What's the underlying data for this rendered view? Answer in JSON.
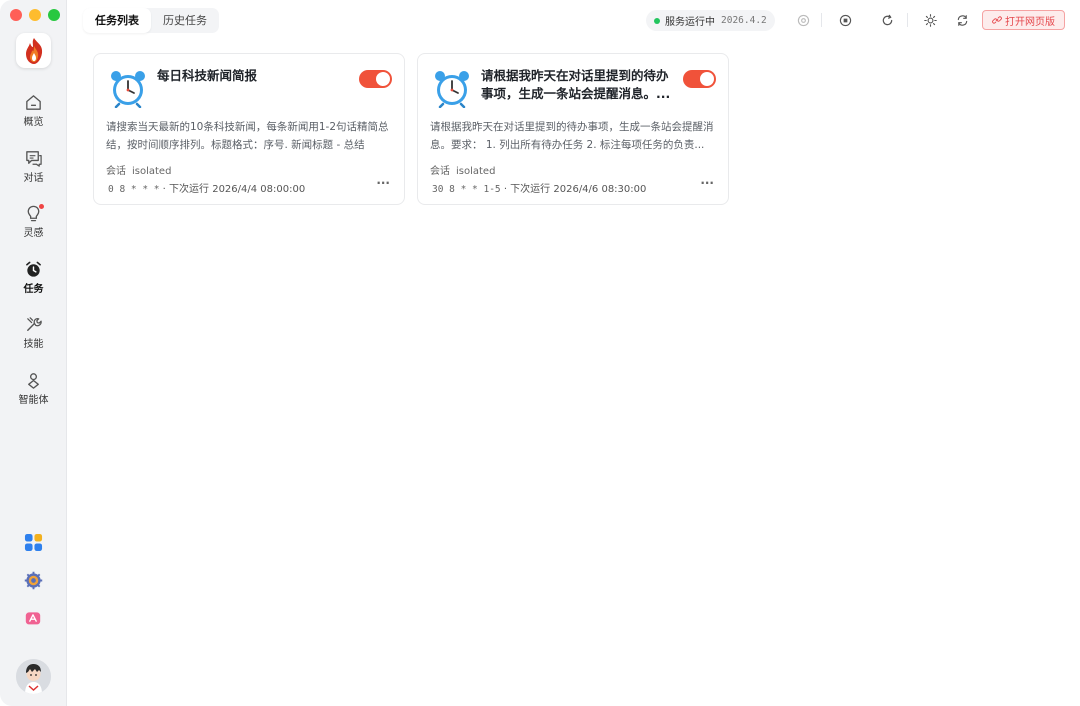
{
  "window": {
    "traffic_lights": [
      "close",
      "minimize",
      "maximize"
    ]
  },
  "sidebar": {
    "logo_icon": "flame-logo",
    "items": [
      {
        "label": "概览",
        "icon": "home-icon"
      },
      {
        "label": "对话",
        "icon": "chat-icon"
      },
      {
        "label": "灵感",
        "icon": "lightbulb-icon",
        "badge": "dot"
      },
      {
        "label": "任务",
        "icon": "alarm-clock-icon",
        "active": true
      },
      {
        "label": "技能",
        "icon": "tools-icon"
      },
      {
        "label": "智能体",
        "icon": "agent-icon"
      }
    ],
    "bottom": [
      "apps-grid-icon",
      "settings-gear-icon",
      "app-store-icon",
      "user-avatar"
    ]
  },
  "header": {
    "tabs": [
      {
        "label": "任务列表",
        "active": true
      },
      {
        "label": "历史任务",
        "active": false
      }
    ],
    "status": {
      "text": "服务运行中",
      "version": "2026.4.2",
      "color": "#22c55e"
    },
    "icons": [
      "target-icon",
      "stop-circle-icon",
      "refresh-icon",
      "sun-icon",
      "sync-icon"
    ],
    "open_web_label": "打开网页版"
  },
  "tasks": [
    {
      "icon": "alarm-clock-icon",
      "title": "每日科技新闻简报",
      "enabled": true,
      "description": "请搜索当天最新的10条科技新闻，每条新闻用1-2句话精简总结，按时间顺序排列。标题格式：序号. 新闻标题 - 总结",
      "session_label": "会话",
      "session_value": "isolated",
      "cron": "0 8 * * *",
      "next_run": "· 下次运行 2026/4/4 08:00:00",
      "more": "···"
    },
    {
      "icon": "alarm-clock-icon",
      "title": "请根据我昨天在对话里提到的待办事项，生成一条站会提醒消息。...",
      "enabled": true,
      "description": "请根据我昨天在对话里提到的待办事项，生成一条站会提醒消息。要求： 1. 列出所有待办任务 2. 标注每项任务的负责...",
      "session_label": "会话",
      "session_value": "isolated",
      "cron": "30 8 * * 1-5",
      "next_run": "· 下次运行 2026/4/6 08:30:00",
      "more": "···"
    }
  ],
  "colors": {
    "accent": "#f0523a",
    "status_green": "#22c55e",
    "sidebar_bg": "#f2f3f5"
  }
}
